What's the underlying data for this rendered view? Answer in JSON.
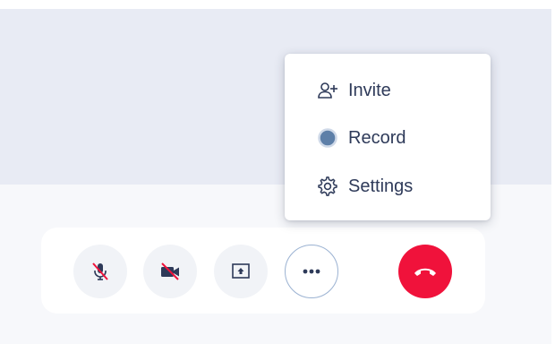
{
  "menu": {
    "items": [
      {
        "label": "Invite",
        "icon": "add-user-icon"
      },
      {
        "label": "Record",
        "icon": "record-dot-icon"
      },
      {
        "label": "Settings",
        "icon": "gear-icon"
      }
    ]
  },
  "controls": [
    {
      "name": "microphone",
      "icon": "microphone-muted-icon",
      "state": "muted"
    },
    {
      "name": "camera",
      "icon": "camera-off-icon",
      "state": "off"
    },
    {
      "name": "screen-share",
      "icon": "screen-share-icon"
    },
    {
      "name": "more",
      "icon": "ellipsis-icon",
      "state": "open"
    },
    {
      "name": "hang-up",
      "icon": "phone-hangup-icon"
    }
  ],
  "colors": {
    "accent": "#2e3a59",
    "muted_slash": "#f0123b",
    "hangup": "#f0123b",
    "icon": "#2e3a59",
    "record_dot": "#5d7fa8"
  }
}
